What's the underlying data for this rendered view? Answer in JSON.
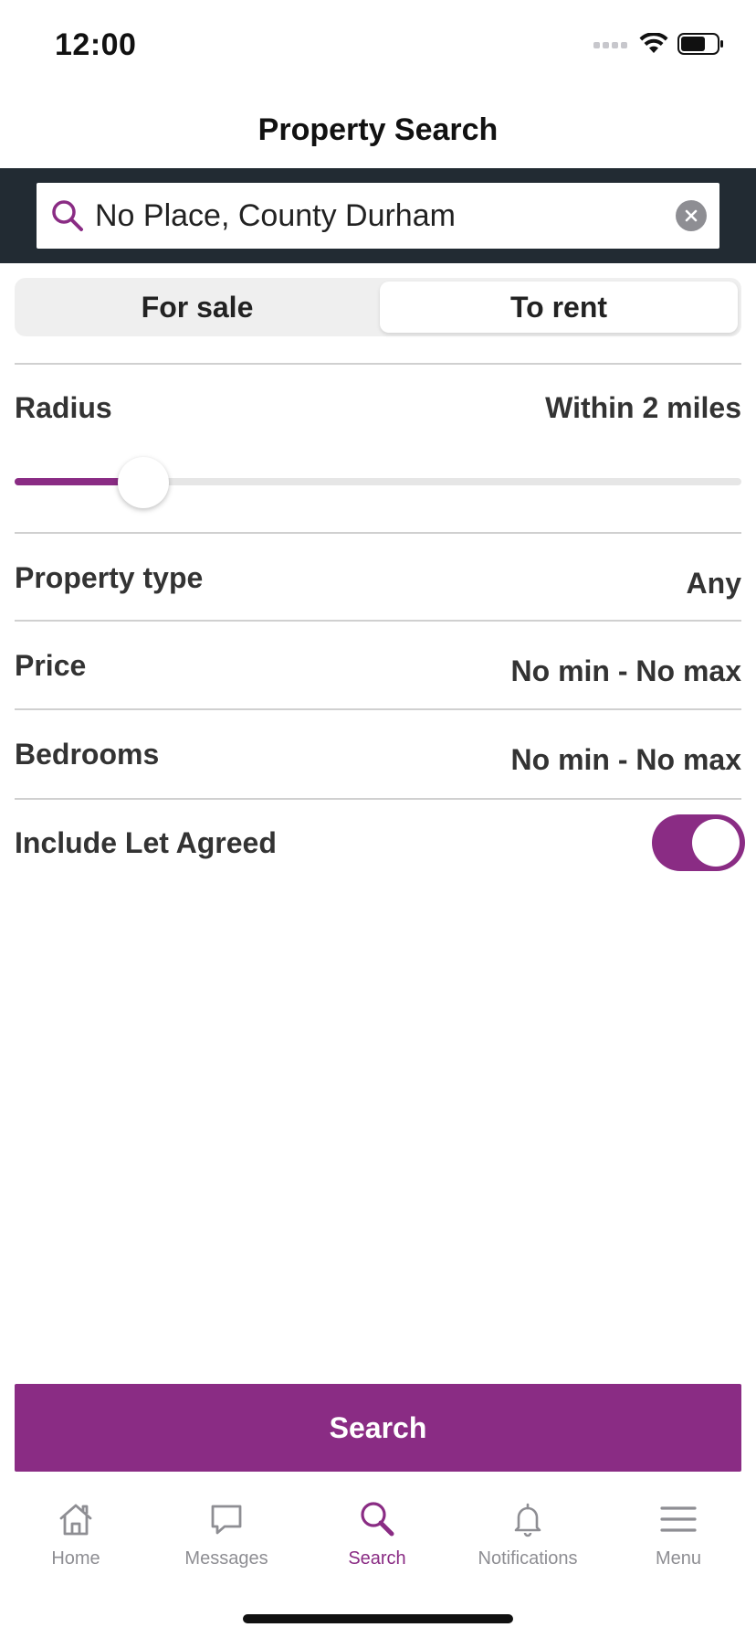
{
  "status_bar": {
    "time": "12:00"
  },
  "nav": {
    "title": "Property Search"
  },
  "search": {
    "value": "No Place, County Durham",
    "placeholder": ""
  },
  "segments": {
    "for_sale": "For sale",
    "to_rent": "To rent",
    "selected": "To rent"
  },
  "filters": {
    "radius": {
      "label": "Radius",
      "value": "Within 2 miles",
      "slider_fraction": 0.165
    },
    "property_type": {
      "label": "Property type",
      "value": "Any"
    },
    "price": {
      "label": "Price",
      "value": "No min - No max"
    },
    "bedrooms": {
      "label": "Bedrooms",
      "value": "No min - No max"
    },
    "let_agreed": {
      "label": "Include Let Agreed",
      "enabled": true
    }
  },
  "actions": {
    "search_label": "Search"
  },
  "tabs": [
    {
      "label": "Home",
      "icon": "home-icon"
    },
    {
      "label": "Messages",
      "icon": "chat-bubble-icon"
    },
    {
      "label": "Search",
      "icon": "search-icon",
      "active": true
    },
    {
      "label": "Notifications",
      "icon": "bell-icon"
    },
    {
      "label": "Menu",
      "icon": "hamburger-menu-icon"
    }
  ],
  "colors": {
    "accent": "#8a2c84",
    "header_band": "#222b33",
    "tab_inactive": "#8e8e93"
  }
}
